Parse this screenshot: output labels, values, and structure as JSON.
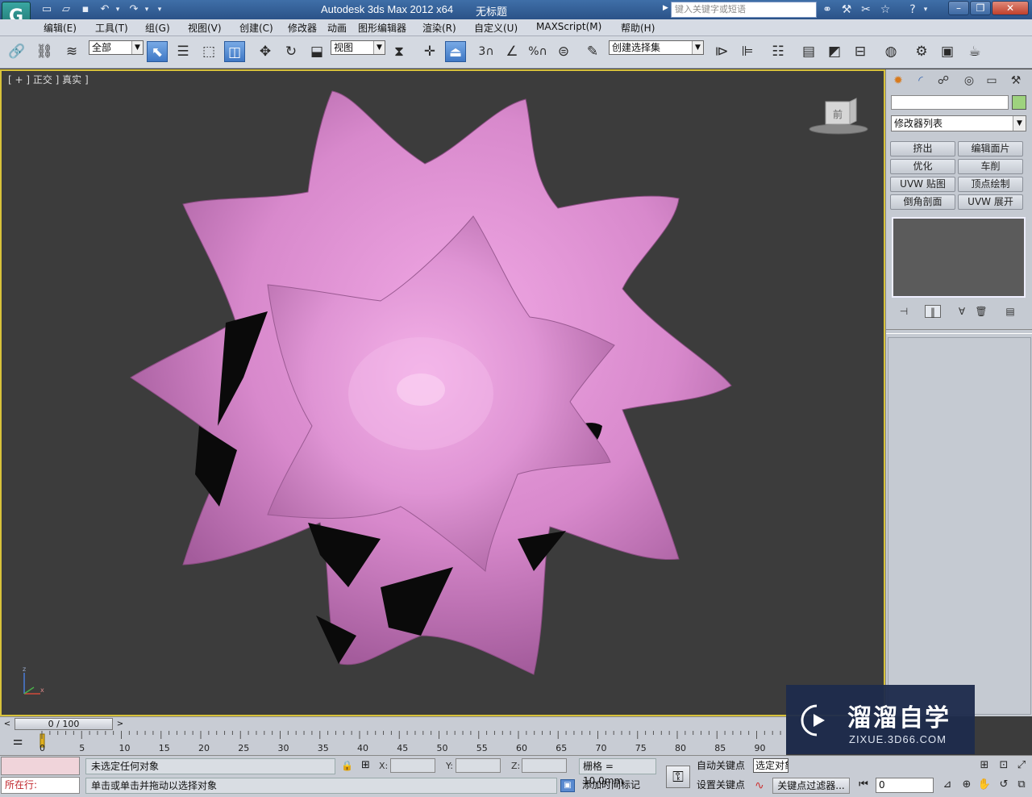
{
  "titlebar": {
    "app_title": "Autodesk 3ds Max  2012 x64",
    "document_name": "无标题",
    "search_placeholder": "键入关键字或短语",
    "logo_glyph": "G"
  },
  "menu": {
    "items": [
      "编辑(E)",
      "工具(T)",
      "组(G)",
      "视图(V)",
      "创建(C)",
      "修改器",
      "动画",
      "图形编辑器",
      "渲染(R)",
      "自定义(U)",
      "MAXScript(M)",
      "帮助(H)"
    ]
  },
  "toolbar": {
    "selection_filter": "全部",
    "ref_coord": "视图",
    "snap_label": "3",
    "named_selection": "创建选择集",
    "percent_label": "%"
  },
  "viewport": {
    "label": "[ + ] 正交 ] 真实 ]",
    "viewcube_label": "前",
    "axis_z": "z",
    "axis_x": "x",
    "object_color": "#e28fd6"
  },
  "command_panel": {
    "modifier_list": "修改器列表",
    "buttons": [
      "挤出",
      "编辑面片",
      "优化",
      "车削",
      "UVW 贴图",
      "顶点绘制",
      "倒角剖面",
      "UVW 展开"
    ],
    "object_color": "#9ed27e"
  },
  "timeline": {
    "frame_display": "0 / 100",
    "ticks": [
      "0",
      "5",
      "10",
      "15",
      "20",
      "25",
      "30",
      "35",
      "40",
      "45",
      "50",
      "55",
      "60",
      "65",
      "70",
      "75",
      "80",
      "85",
      "90"
    ]
  },
  "status": {
    "listener_text": "所在行:",
    "selection_status": "未选定任何对象",
    "prompt": "单击或单击并拖动以选择对象",
    "x_label": "X:",
    "y_label": "Y:",
    "z_label": "Z:",
    "grid": "栅格 = 10.0mm",
    "add_time_tag": "添加时间标记",
    "auto_key": "自动关键点",
    "auto_key_target": "选定对象",
    "set_key": "设置关键点",
    "key_filters": "关键点过滤器...",
    "current_frame": "0"
  },
  "watermark": {
    "title": "溜溜自学",
    "url": "ZIXUE.3D66.COM"
  }
}
